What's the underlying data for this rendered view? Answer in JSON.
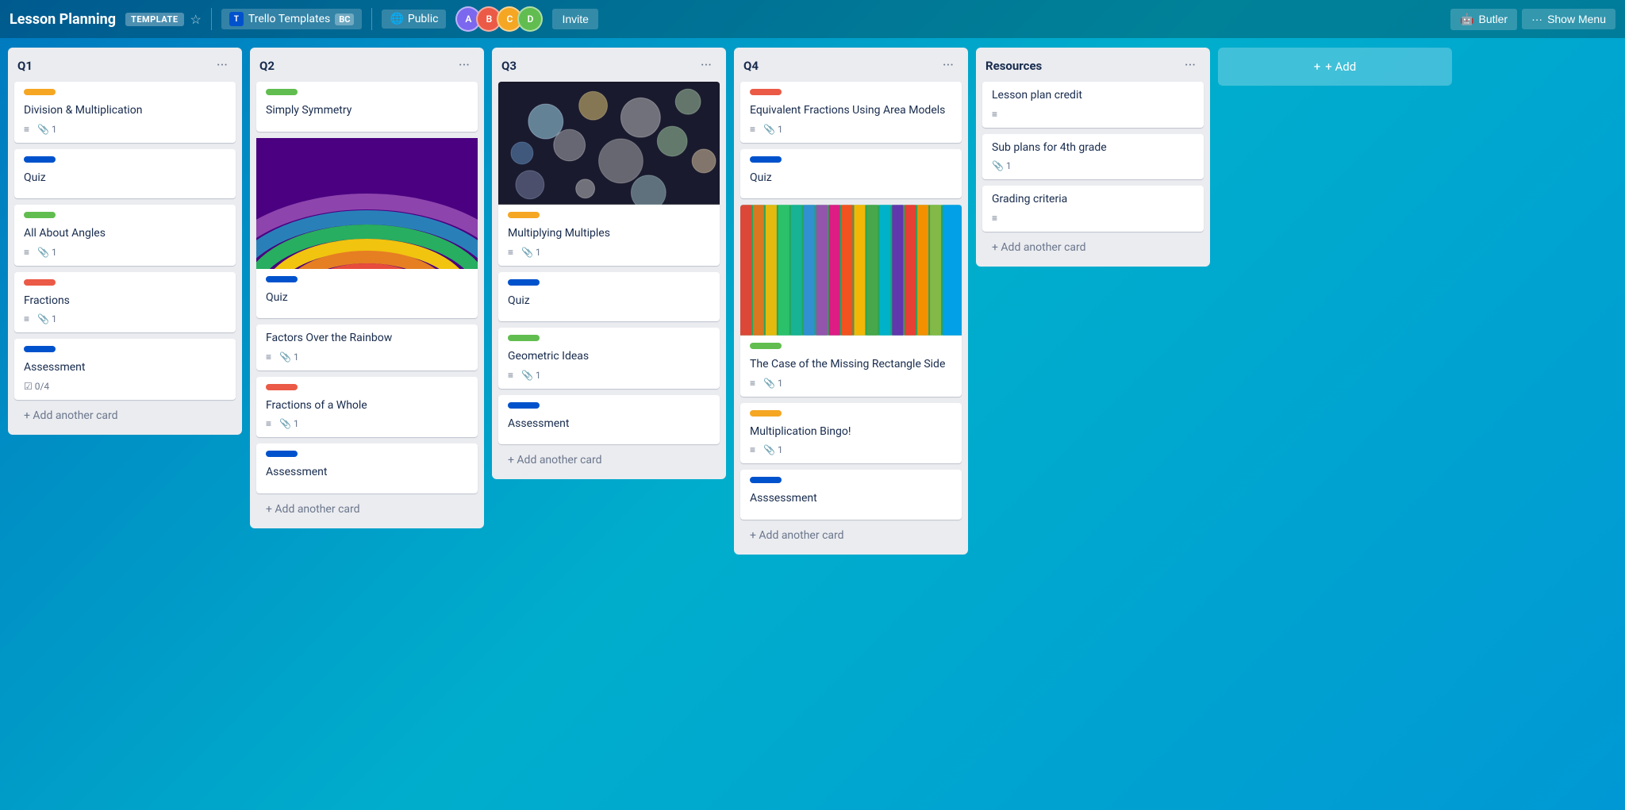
{
  "header": {
    "title": "Lesson Planning",
    "template_badge": "TEMPLATE",
    "workspace_name": "Trello Templates",
    "workspace_code": "BC",
    "visibility": "Public",
    "invite_label": "Invite",
    "butler_label": "Butler",
    "show_menu_label": "Show Menu"
  },
  "board": {
    "columns": [
      {
        "id": "q1",
        "title": "Q1",
        "cards": [
          {
            "id": "q1c1",
            "label_color": "#f5a623",
            "title": "Division & Multiplication",
            "has_description": true,
            "attachments": 1
          },
          {
            "id": "q1c2",
            "label_color": "#0052cc",
            "title": "Quiz",
            "has_description": false,
            "attachments": null
          },
          {
            "id": "q1c3",
            "label_color": "#61bd4f",
            "title": "All About Angles",
            "has_description": true,
            "attachments": 1
          },
          {
            "id": "q1c4",
            "label_color": "#eb5a46",
            "title": "Fractions",
            "has_description": true,
            "attachments": 1
          },
          {
            "id": "q1c5",
            "label_color": "#0052cc",
            "title": "Assessment",
            "has_description": false,
            "checklist": "0/4",
            "attachments": null
          }
        ],
        "add_card_label": "+ Add another card"
      },
      {
        "id": "q2",
        "title": "Q2",
        "cards": [
          {
            "id": "q2c1",
            "label_color": "#61bd4f",
            "title": "Simply Symmetry",
            "has_description": false,
            "attachments": null
          },
          {
            "id": "q2c2",
            "label_color": "#0052cc",
            "title": "Quiz",
            "has_description": false,
            "attachments": null,
            "has_image": "rainbow"
          },
          {
            "id": "q2c3",
            "label_color": null,
            "title": "Factors Over the Rainbow",
            "has_description": true,
            "attachments": 1,
            "is_after_image": true
          },
          {
            "id": "q2c4",
            "label_color": "#eb5a46",
            "title": "Fractions of a Whole",
            "has_description": true,
            "attachments": 1
          },
          {
            "id": "q2c5",
            "label_color": "#0052cc",
            "title": "Assessment",
            "has_description": false,
            "attachments": null
          }
        ],
        "add_card_label": "+ Add another card"
      },
      {
        "id": "q3",
        "title": "Q3",
        "cards": [
          {
            "id": "q3c1",
            "has_image": "bubbles",
            "label_color": "#f5a623",
            "title": "Multiplying Multiples",
            "has_description": true,
            "attachments": 1
          },
          {
            "id": "q3c2",
            "label_color": "#0052cc",
            "title": "Quiz",
            "has_description": false,
            "attachments": null
          },
          {
            "id": "q3c3",
            "label_color": "#61bd4f",
            "title": "Geometric Ideas",
            "has_description": true,
            "attachments": 1
          },
          {
            "id": "q3c4",
            "label_color": "#0052cc",
            "title": "Assessment",
            "has_description": false,
            "attachments": null
          }
        ],
        "add_card_label": "+ Add another card"
      },
      {
        "id": "q4",
        "title": "Q4",
        "cards": [
          {
            "id": "q4c1",
            "label_color": "#eb5a46",
            "title": "Equivalent Fractions Using Area Models",
            "has_description": true,
            "attachments": 1
          },
          {
            "id": "q4c2",
            "label_color": "#0052cc",
            "title": "Quiz",
            "has_description": false,
            "attachments": null
          },
          {
            "id": "q4c3",
            "has_image": "colorful",
            "label_color": "#61bd4f",
            "title": "The Case of the Missing Rectangle Side",
            "has_description": true,
            "attachments": 1,
            "is_after_image": true
          },
          {
            "id": "q4c4",
            "label_color": "#f5a623",
            "title": "Multiplication Bingo!",
            "has_description": true,
            "attachments": 1
          },
          {
            "id": "q4c5",
            "label_color": "#0052cc",
            "title": "Asssessment",
            "has_description": false,
            "attachments": null
          }
        ],
        "add_card_label": "+ Add another card"
      }
    ],
    "resources_column": {
      "title": "Resources",
      "cards": [
        {
          "id": "rc1",
          "title": "Lesson plan credit",
          "has_description": true,
          "attachments": null
        },
        {
          "id": "rc2",
          "title": "Sub plans for 4th grade",
          "has_description": false,
          "attachments": 1
        },
        {
          "id": "rc3",
          "title": "Grading criteria",
          "has_description": true,
          "attachments": null
        }
      ],
      "add_card_label": "+ Add another card"
    },
    "add_list_label": "+ Add"
  }
}
